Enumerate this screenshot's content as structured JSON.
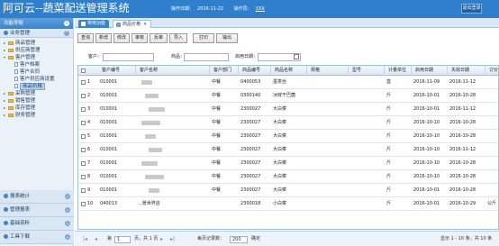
{
  "app": {
    "title": "阿可云--蔬菜配送管理系统",
    "date_label": "操作日期：",
    "date": "2016-11-22",
    "operator_label": "操作员：",
    "operator": "XXX",
    "logout": "退出登录"
  },
  "sidebar": {
    "header": "功能导航",
    "group_business": "业务管理",
    "tree": [
      {
        "label": "商品管理",
        "level": 1,
        "expanded": false
      },
      {
        "label": "供应商管理",
        "level": 1,
        "expanded": false
      },
      {
        "label": "客户管理",
        "level": 1,
        "expanded": true
      },
      {
        "label": "客户档案",
        "level": 2
      },
      {
        "label": "客户合同",
        "level": 2
      },
      {
        "label": "客户供应商设置",
        "level": 2
      },
      {
        "label": "商品价格",
        "level": 2,
        "selected": true
      },
      {
        "label": "采购管理",
        "level": 1,
        "expanded": false
      },
      {
        "label": "销售管理",
        "level": 1,
        "expanded": false
      },
      {
        "label": "库存管理",
        "level": 1,
        "expanded": false
      },
      {
        "label": "财务管理",
        "level": 1,
        "expanded": false
      }
    ],
    "bottom_groups": [
      "报表统计",
      "管理报表",
      "基础资料",
      "工具下载"
    ]
  },
  "tabs": [
    {
      "label": "常用功能",
      "active": false
    },
    {
      "label": "商品价格",
      "active": true
    }
  ],
  "toolbar": [
    "查询",
    "新增",
    "修改",
    "审核",
    "反审",
    "导入",
    "打印",
    "输出"
  ],
  "search": {
    "customer_label": "客户：",
    "product_label": "商品：",
    "date_label": "启用日期："
  },
  "grid": {
    "columns": [
      "客户编号",
      "客户名称",
      "客户部门",
      "商品编号",
      "商品名称",
      "规格",
      "型号",
      "计量单位",
      "启用日期",
      "失效日期",
      "订价"
    ],
    "rows": [
      {
        "n": "1",
        "cust_no": "010001",
        "dept": "中餐",
        "prod_no": "0400053",
        "prod_name": "墨茶丝",
        "unit": "盒",
        "start": "2016-11-09",
        "end": "2016-11-12"
      },
      {
        "n": "2",
        "cust_no": "010001",
        "dept": "中餐",
        "prod_no": "0300140",
        "prod_name": "冰鲜干巴菌",
        "unit": "斤",
        "start": "2016-10-01",
        "end": "2016-10-28"
      },
      {
        "n": "3",
        "cust_no": "010001",
        "dept": "中餐",
        "prod_no": "2300027",
        "prod_name": "大白菜",
        "unit": "斤",
        "start": "2016-10-01",
        "end": "2016-11-12"
      },
      {
        "n": "4",
        "cust_no": "010001",
        "dept": "中餐",
        "prod_no": "2300027",
        "prod_name": "大白菜",
        "unit": "斤",
        "start": "2016-10-10",
        "end": "2016-10-28"
      },
      {
        "n": "5",
        "cust_no": "010001",
        "dept": "中餐",
        "prod_no": "2300027",
        "prod_name": "大白菜",
        "unit": "斤",
        "start": "2016-10-10",
        "end": "2016-10-28"
      },
      {
        "n": "6",
        "cust_no": "010001",
        "dept": "中餐",
        "prod_no": "2300027",
        "prod_name": "大白菜",
        "unit": "斤",
        "start": "2016-10-10",
        "end": "2016-11-12"
      },
      {
        "n": "7",
        "cust_no": "010001",
        "dept": "中餐",
        "prod_no": "2300027",
        "prod_name": "大白菜",
        "unit": "斤",
        "start": "2016-10-10",
        "end": "2016-10-28"
      },
      {
        "n": "8",
        "cust_no": "010001",
        "dept": "中餐",
        "prod_no": "2300027",
        "prod_name": "大白菜",
        "unit": "斤",
        "start": "2016-10-10",
        "end": "2016-10-28"
      },
      {
        "n": "9",
        "cust_no": "010001",
        "dept": "中餐",
        "prod_no": "2300027",
        "prod_name": "大白菜",
        "unit": "斤",
        "start": "2016-10-01",
        "end": "2016-10-28"
      },
      {
        "n": "10",
        "cust_no": "040013",
        "cust_name": "...景世界店",
        "dept": "",
        "prod_no": "2300018",
        "prod_name": "小白菜",
        "unit": "斤",
        "start": "2016-10-01",
        "end": "2016-10-29",
        "price": "公斤"
      }
    ]
  },
  "pager": {
    "page_label": "第",
    "page": "1",
    "of_pages": "页，共 1 页",
    "page_size_label": "每页记录数：",
    "page_size": "200",
    "confirm": "确定",
    "summary": "显示 1 - 10 条，共 10 条"
  }
}
